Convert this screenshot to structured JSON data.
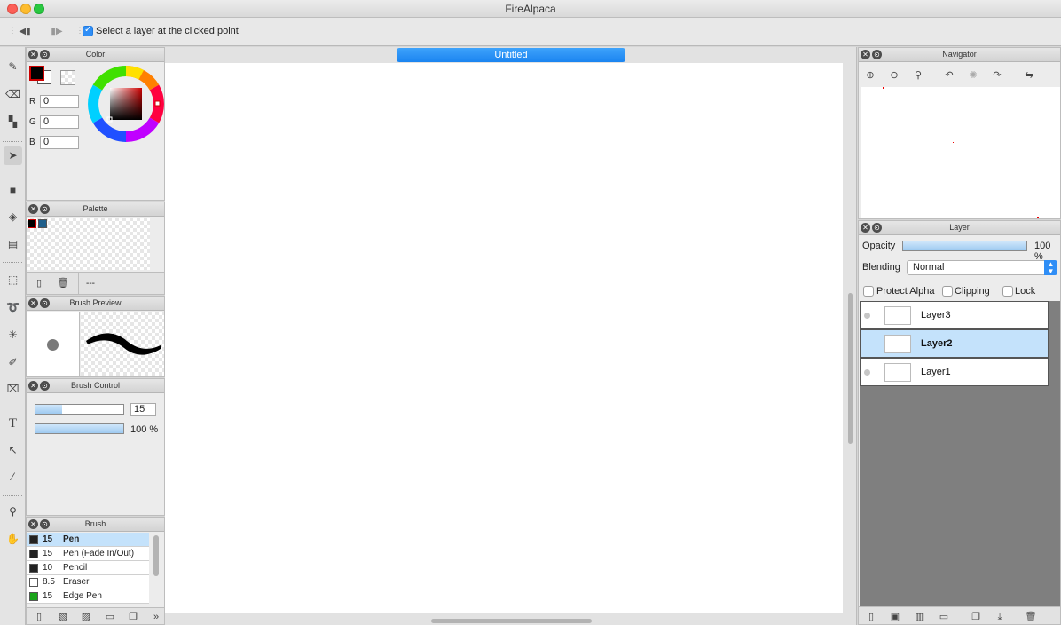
{
  "window": {
    "title": "FireAlpaca"
  },
  "toolbar": {
    "prev_icon": "step-back-icon",
    "next_icon": "step-forward-icon",
    "select_layer_label": "Select a layer at the clicked point",
    "select_layer_checked": true
  },
  "color_panel": {
    "title": "Color",
    "r_label": "R",
    "r_value": "0",
    "g_label": "G",
    "g_value": "0",
    "b_label": "B",
    "b_value": "0",
    "foreground": "#000000",
    "background": "#ffffff",
    "accent": "#cc0000"
  },
  "palette_panel": {
    "title": "Palette",
    "swatches": [
      "#000000",
      "#1f5f8b"
    ],
    "name": "---"
  },
  "brush_preview_panel": {
    "title": "Brush Preview"
  },
  "brush_control_panel": {
    "title": "Brush Control",
    "size_value": "15",
    "size_fraction": 0.3,
    "opacity_value": "100 %",
    "opacity_fraction": 1.0
  },
  "brush_panel": {
    "title": "Brush",
    "items": [
      {
        "size": "15",
        "name": "Pen",
        "color": "#222222"
      },
      {
        "size": "15",
        "name": "Pen (Fade In/Out)",
        "color": "#222222"
      },
      {
        "size": "10",
        "name": "Pencil",
        "color": "#222222"
      },
      {
        "size": "8.5",
        "name": "Eraser",
        "color": "#ffffff"
      },
      {
        "size": "15",
        "name": "Edge Pen",
        "color": "#1aa31a"
      }
    ],
    "selected_index": 0
  },
  "document": {
    "tab_title": "Untitled"
  },
  "navigator_panel": {
    "title": "Navigator"
  },
  "layer_panel": {
    "title": "Layer",
    "opacity_label": "Opacity",
    "opacity_value": "100 %",
    "opacity_fraction": 1.0,
    "blending_label": "Blending",
    "blending_value": "Normal",
    "protect_alpha_label": "Protect Alpha",
    "clipping_label": "Clipping",
    "lock_label": "Lock",
    "layers": [
      {
        "name": "Layer3",
        "selected": false
      },
      {
        "name": "Layer2",
        "selected": true
      },
      {
        "name": "Layer1",
        "selected": false
      }
    ]
  }
}
